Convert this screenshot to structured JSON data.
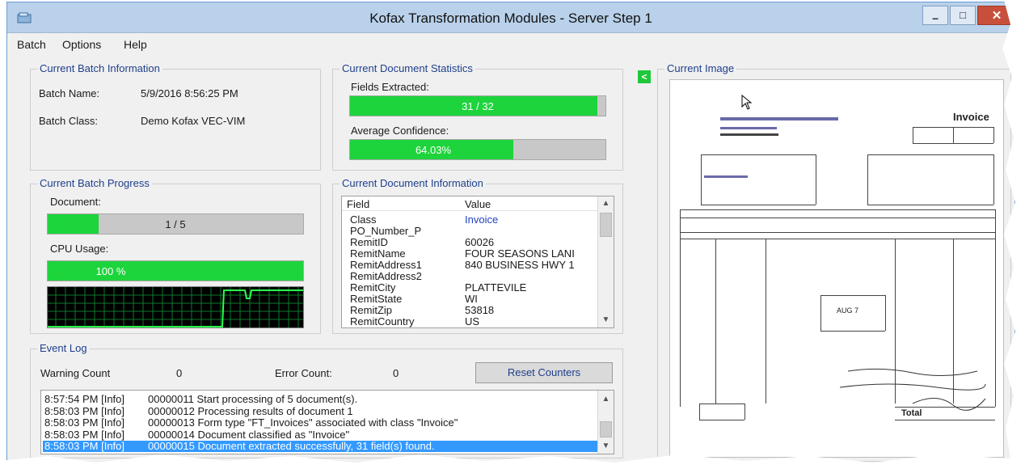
{
  "window": {
    "title": "Kofax Transformation Modules - Server Step 1",
    "controls": {
      "minimize": "–",
      "maximize": "□",
      "close": "✕"
    }
  },
  "menu": {
    "items": [
      "Batch",
      "Options",
      "Help"
    ]
  },
  "batch_info": {
    "title": "Current Batch Information",
    "name_label": "Batch Name:",
    "name_value": "5/9/2016 8:56:25 PM",
    "class_label": "Batch Class:",
    "class_value": "Demo Kofax VEC-VIM"
  },
  "doc_stats": {
    "title": "Current Document Statistics",
    "fields_label": "Fields Extracted:",
    "fields_value": "31 / 32",
    "fields_fraction": 0.969,
    "confidence_label": "Average Confidence:",
    "confidence_value": "64.03%",
    "confidence_fraction": 0.6403
  },
  "batch_progress": {
    "title": "Current Batch Progress",
    "document_label": "Document:",
    "document_value": "1 / 5",
    "document_fraction": 0.2,
    "cpu_label": "CPU Usage:",
    "cpu_value": "100 %",
    "cpu_fraction": 1.0
  },
  "doc_info": {
    "title": "Current Document Information",
    "col_field": "Field",
    "col_value": "Value",
    "rows": [
      {
        "field": "Class",
        "value": "Invoice"
      },
      {
        "field": "PO_Number_P",
        "value": ""
      },
      {
        "field": "RemitID",
        "value": "60026"
      },
      {
        "field": "RemitName",
        "value": "FOUR SEASONS LANI"
      },
      {
        "field": "RemitAddress1",
        "value": "840 BUSINESS HWY 1"
      },
      {
        "field": "RemitAddress2",
        "value": ""
      },
      {
        "field": "RemitCity",
        "value": "PLATTEVILE"
      },
      {
        "field": "RemitState",
        "value": "WI"
      },
      {
        "field": "RemitZip",
        "value": "53818"
      },
      {
        "field": "RemitCountry",
        "value": "US"
      }
    ]
  },
  "event_log": {
    "title": "Event Log",
    "warning_label": "Warning Count",
    "warning_value": "0",
    "error_label": "Error Count:",
    "error_value": "0",
    "reset_label": "Reset Counters",
    "entries": [
      {
        "time": "8:57:54 PM [Info]",
        "message": "00000011 Start processing of 5 document(s)."
      },
      {
        "time": "8:58:03 PM [Info]",
        "message": "00000012 Processing results of document 1"
      },
      {
        "time": "8:58:03 PM [Info]",
        "message": "00000013 Form type \"FT_Invoices\" associated with class \"Invoice\""
      },
      {
        "time": "8:58:03 PM [Info]",
        "message": "00000014 Document classified as \"Invoice\""
      },
      {
        "time": "8:58:03 PM [Info]",
        "message": "00000015 Document extracted successfully, 31 field(s) found."
      }
    ]
  },
  "current_image": {
    "title": "Current Image",
    "collapse_glyph": "<",
    "doc": {
      "heading": "Invoice",
      "total_label": "Total"
    }
  },
  "colors": {
    "progress_fill": "#1ed43c",
    "group_title": "#1e3f8c",
    "selection": "#3399ff"
  }
}
